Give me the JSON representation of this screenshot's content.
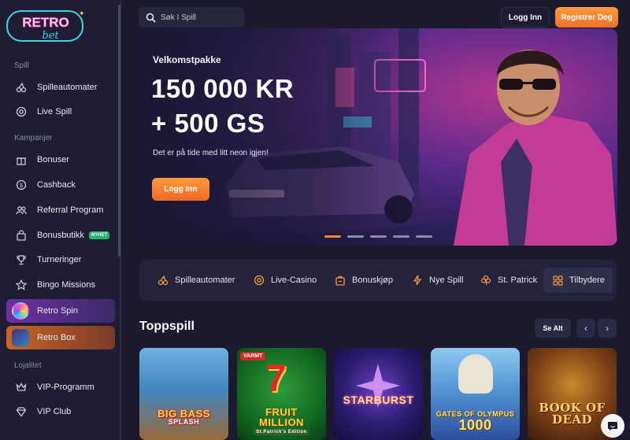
{
  "brand": {
    "logo_line1": "RETRO",
    "logo_line2": "bet"
  },
  "sidebar": {
    "section_spill": "Spill",
    "section_kampanjer": "Kampanjer",
    "section_lojalitet": "Lojalitet",
    "items": [
      {
        "label": "Spilleautomater",
        "icon": "cherries-icon"
      },
      {
        "label": "Live Spill",
        "icon": "chip-icon"
      },
      {
        "label": "Bonuser",
        "icon": "gift-icon"
      },
      {
        "label": "Cashback",
        "icon": "coin-icon"
      },
      {
        "label": "Referral Program",
        "icon": "users-icon"
      },
      {
        "label": "Bonusbutikk",
        "icon": "bag-icon",
        "badge": "NYHET"
      },
      {
        "label": "Turneringer",
        "icon": "trophy-icon"
      },
      {
        "label": "Bingo Missions",
        "icon": "star-icon"
      },
      {
        "label": "Retro Spin",
        "icon": "wheel-icon"
      },
      {
        "label": "Retro Box",
        "icon": "box-icon"
      },
      {
        "label": "VIP-Programm",
        "icon": "crown-icon"
      },
      {
        "label": "VIP Club",
        "icon": "diamond-icon"
      }
    ]
  },
  "topbar": {
    "search_placeholder": "Søk I Spill",
    "login_label": "Logg Inn",
    "register_label": "Registrer Deg"
  },
  "hero": {
    "eyebrow": "Velkomstpakke",
    "line1": "150 000 KR",
    "line2": "+ 500 GS",
    "subtitle": "Det er på tide med litt neon igjen!",
    "cta": "Logg Inn",
    "slides_total": 5,
    "slide_active": 1
  },
  "categories": [
    {
      "label": "Spilleautomater",
      "icon": "cherries-icon"
    },
    {
      "label": "Live-Casino",
      "icon": "chip-icon"
    },
    {
      "label": "Bonuskjøp",
      "icon": "cart-icon"
    },
    {
      "label": "Nye Spill",
      "icon": "bolt-icon"
    },
    {
      "label": "St. Patrick",
      "icon": "clover-icon"
    },
    {
      "label": "Tilbydere",
      "icon": "grid-icon"
    }
  ],
  "topgames": {
    "title": "Toppspill",
    "see_all": "Se Alt",
    "prev": "‹",
    "next": "›",
    "games": [
      {
        "name": "BIG BASS SPLASH",
        "line1": "BIG BASS",
        "line2": "SPLASH"
      },
      {
        "name": "FRUIT MILLION",
        "line1": "FRUIT",
        "line2": "MILLION",
        "tag": "VARMT",
        "sub": "St.Patrick's Edition"
      },
      {
        "name": "STARBURST",
        "line1": "STARBURST",
        "line2": ""
      },
      {
        "name": "GATES OF OLYMPUS 1000",
        "line1": "GATES OF OLYMPUS",
        "line2": "1000"
      },
      {
        "name": "BOOK OF DEAD",
        "line1": "BOOK OF",
        "line2": "DEAD"
      }
    ]
  },
  "colors": {
    "accent": "#f0822e",
    "bg": "#1b1a2e",
    "sidebar": "#1e1d33",
    "badge_green": "#23b36b"
  }
}
